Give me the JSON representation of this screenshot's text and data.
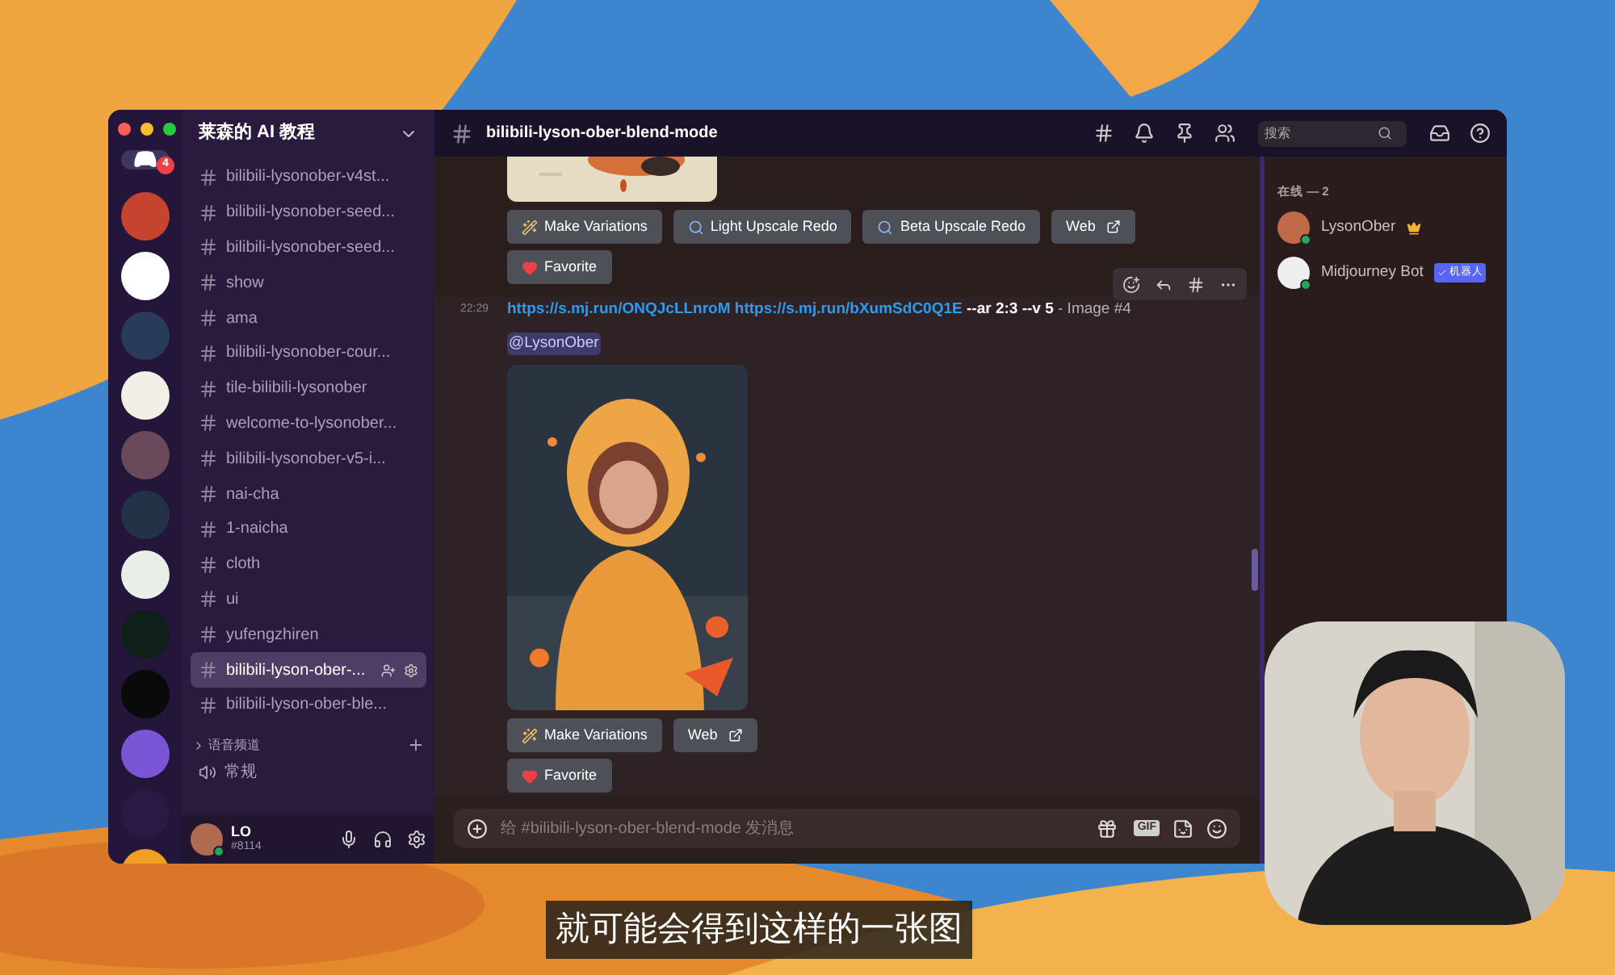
{
  "window": {
    "server_badge": "4"
  },
  "sidebar": {
    "title": "莱森的 AI 教程",
    "channels": [
      {
        "name": "bilibili-lysonober-v4st...",
        "selected": false
      },
      {
        "name": "bilibili-lysonober-seed...",
        "selected": false
      },
      {
        "name": "bilibili-lysonober-seed...",
        "selected": false
      },
      {
        "name": "show",
        "selected": false
      },
      {
        "name": "ama",
        "selected": false
      },
      {
        "name": "bilibili-lysonober-cour...",
        "selected": false
      },
      {
        "name": "tile-bilibili-lysonober",
        "selected": false
      },
      {
        "name": "welcome-to-lysonober...",
        "selected": false
      },
      {
        "name": "bilibili-lysonober-v5-i...",
        "selected": false
      },
      {
        "name": "nai-cha",
        "selected": false
      },
      {
        "name": "1-naicha",
        "selected": false
      },
      {
        "name": "cloth",
        "selected": false
      },
      {
        "name": "ui",
        "selected": false
      },
      {
        "name": "yufengzhiren",
        "selected": false
      },
      {
        "name": "bilibili-lyson-ober-...",
        "selected": true
      },
      {
        "name": "bilibili-lyson-ober-ble...",
        "selected": false
      }
    ],
    "voice_category": "语音频道",
    "voice_channels": [
      "常规"
    ],
    "user": {
      "name": "LO",
      "tag": "#8114"
    }
  },
  "header": {
    "channel": "bilibili-lyson-ober-blend-mode",
    "search_placeholder": "搜索"
  },
  "messages": [
    {
      "hovered": false,
      "buttons": [
        {
          "kind": "variations",
          "label": "Make Variations"
        },
        {
          "kind": "upscale",
          "label": "Light Upscale Redo"
        },
        {
          "kind": "upscale",
          "label": "Beta Upscale Redo"
        },
        {
          "kind": "web",
          "label": "Web"
        }
      ],
      "favorite": "Favorite"
    },
    {
      "hovered": true,
      "time": "22:29",
      "parts": [
        {
          "kind": "link",
          "text": "https://s.mj.run/ONQJcLLnroM"
        },
        {
          "kind": "link",
          "text": "https://s.mj.run/bXumSdC0Q1E"
        },
        {
          "kind": "bold",
          "text": "--ar 2:3 --v 5"
        },
        {
          "kind": "plain",
          "text": "- Image #4"
        }
      ],
      "mention": "@LysonOber",
      "buttons": [
        {
          "kind": "variations",
          "label": "Make Variations"
        },
        {
          "kind": "web",
          "label": "Web"
        }
      ],
      "favorite": "Favorite"
    }
  ],
  "composer": {
    "placeholder": "给 #bilibili-lyson-ober-blend-mode 发消息",
    "gif_label": "GIF"
  },
  "members": {
    "heading": "在线 — 2",
    "items": [
      {
        "name": "LysonOber",
        "kind": "owner"
      },
      {
        "name": "Midjourney Bot",
        "kind": "bot",
        "badge": "机器人"
      }
    ]
  },
  "subtitle": "就可能会得到这样的一张图"
}
